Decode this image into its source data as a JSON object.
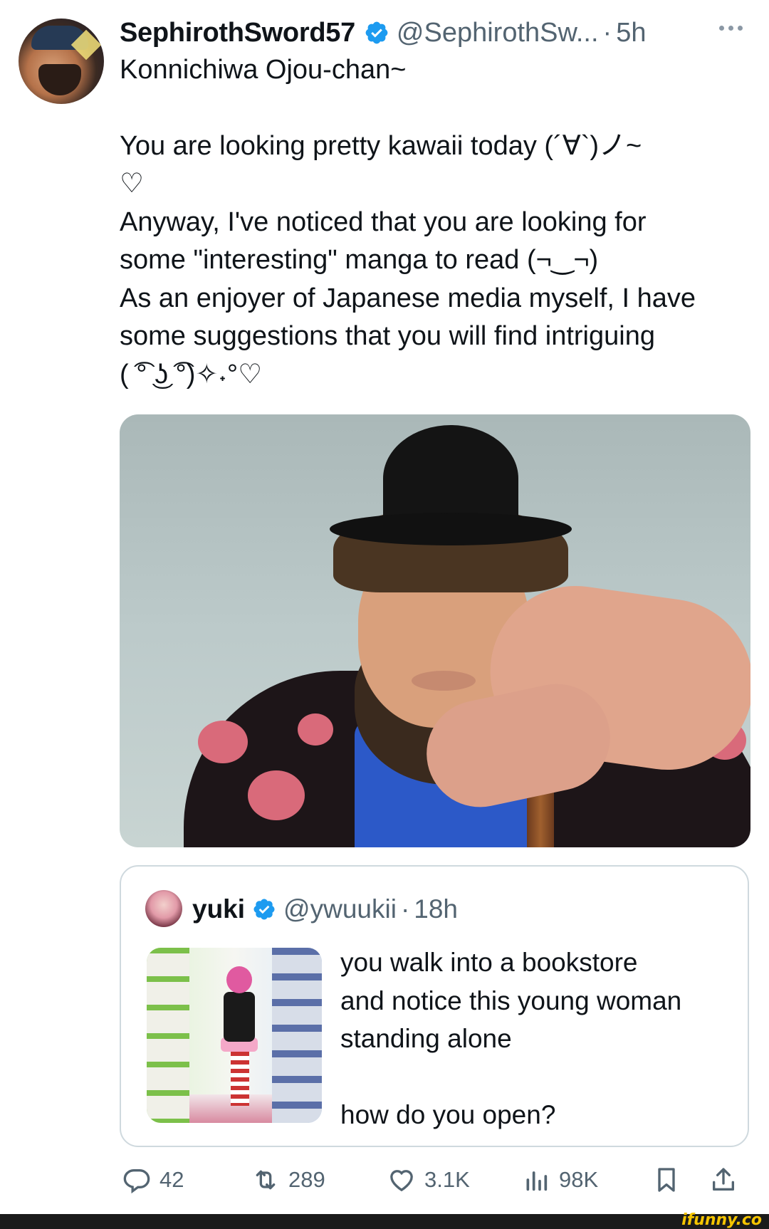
{
  "author": {
    "display_name": "SephirothSword57",
    "handle": "@SephirothSw...",
    "separator": "·",
    "time": "5h",
    "verified_color": "#1d9bf0"
  },
  "tweet": {
    "paragraphs_a": [
      "Konnichiwa Ojou-chan~"
    ],
    "paragraphs_b": [
      "You are looking pretty kawaii today (´∀`)ノ~",
      "♡",
      "Anyway, I've noticed that you are looking for",
      "some \"interesting\" manga to read (¬‿¬)",
      "As an enjoyer of Japanese media myself, I have",
      "some suggestions that you will find intriguing",
      "( ͡° ͜ʖ ͡°)✧˖°♡"
    ]
  },
  "quoted": {
    "display_name": "yuki",
    "handle": "@ywuukii",
    "separator": "·",
    "time": "18h",
    "lines_a": [
      "you walk into a bookstore",
      "and notice this young woman",
      "standing alone"
    ],
    "lines_b": [
      "how do you open?"
    ]
  },
  "actions": {
    "replies": "42",
    "reposts": "289",
    "likes": "3.1K",
    "views": "98K"
  },
  "watermark": "ifunny.co",
  "colors": {
    "text": "#0f1419",
    "secondary": "#536471",
    "border": "#cfd9de",
    "verified": "#1d9bf0"
  },
  "icons": [
    "more-icon",
    "verified-icon",
    "reply-icon",
    "repost-icon",
    "like-icon",
    "views-icon",
    "bookmark-icon",
    "share-icon"
  ]
}
